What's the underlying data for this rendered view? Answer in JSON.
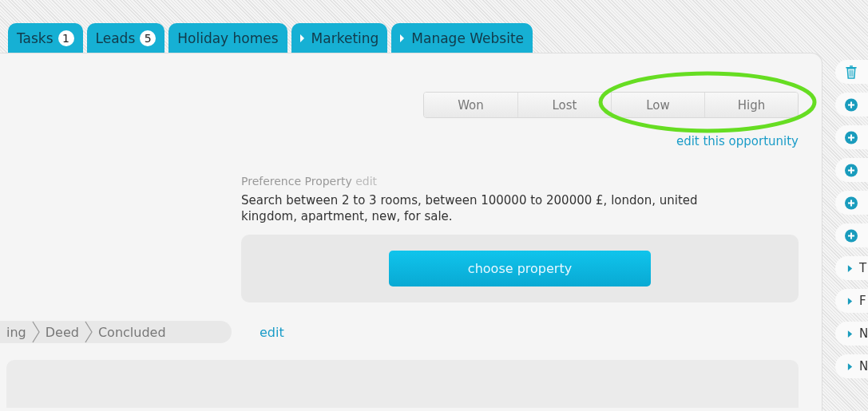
{
  "tabs": [
    {
      "label": "Tasks",
      "count": "1"
    },
    {
      "label": "Leads",
      "count": "5"
    },
    {
      "label": "Holiday homes"
    },
    {
      "label": "Marketing",
      "arrow": true
    },
    {
      "label": "Manage Website",
      "arrow": true
    }
  ],
  "status_buttons": [
    "Won",
    "Lost",
    "Low",
    "High"
  ],
  "edit_opportunity_link": "edit this opportunity",
  "preference": {
    "label": "Preference Property",
    "edit_link": "edit",
    "description": "Search between 2 to 3 rooms, between 100000 to 200000 £, london, united kingdom, apartment, new, for sale.",
    "button": "choose property"
  },
  "pipeline": {
    "stages": [
      "ing",
      "Deed",
      "Concluded"
    ],
    "edit_link": "edit"
  },
  "sidebar": [
    {
      "kind": "trash"
    },
    {
      "kind": "add"
    },
    {
      "kind": "add"
    },
    {
      "kind": "add"
    },
    {
      "kind": "add"
    },
    {
      "kind": "add"
    },
    {
      "kind": "expand",
      "label": "T"
    },
    {
      "kind": "expand",
      "label": "F"
    },
    {
      "kind": "expand",
      "label": "N"
    },
    {
      "kind": "expand",
      "label": "N"
    }
  ]
}
